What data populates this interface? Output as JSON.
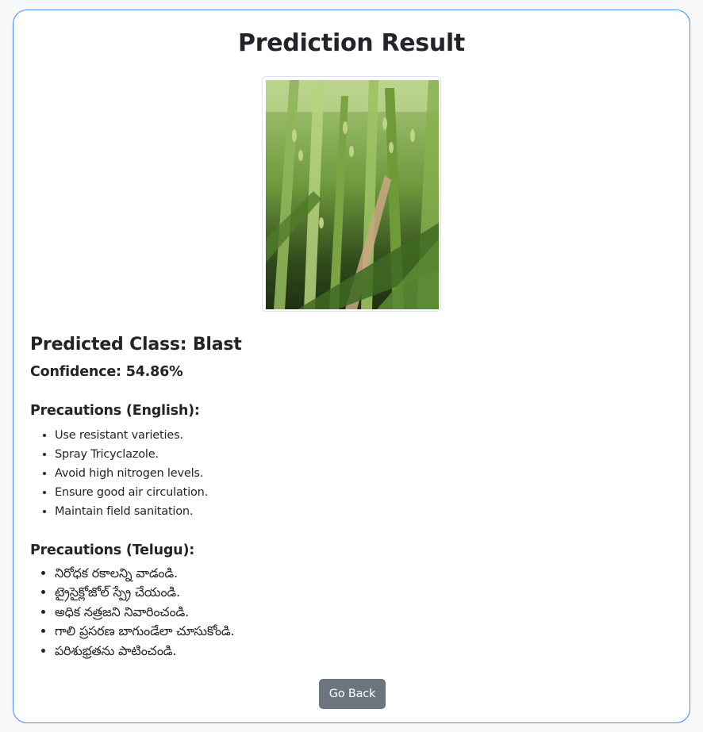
{
  "page": {
    "title": "Prediction Result"
  },
  "image": {
    "subject": "rice crop plants"
  },
  "result": {
    "predicted_class": "Predicted Class: Blast",
    "confidence": "Confidence: 54.86%"
  },
  "precautions_english": {
    "heading": "Precautions (English):",
    "items": [
      "Use resistant varieties.",
      "Spray Tricyclazole.",
      "Avoid high nitrogen levels.",
      "Ensure good air circulation.",
      "Maintain field sanitation."
    ]
  },
  "precautions_telugu": {
    "heading": "Precautions (Telugu):",
    "items": [
      "నిరోధక రకాలన్ని వాడండి.",
      "ట్రైసైక్లోజోల్ స్ప్రే చేయండి.",
      "అధిక నత్రజని నివారించండి.",
      "గాలి ప్రసరణ బాగుండేలా చూసుకోండి.",
      "పరిశుభ్రతను పాటించండి."
    ]
  },
  "actions": {
    "go_back_label": "Go Back"
  },
  "colors": {
    "card_border": "#3d8bfd",
    "button_bg": "#6c757d",
    "text": "#212529"
  }
}
